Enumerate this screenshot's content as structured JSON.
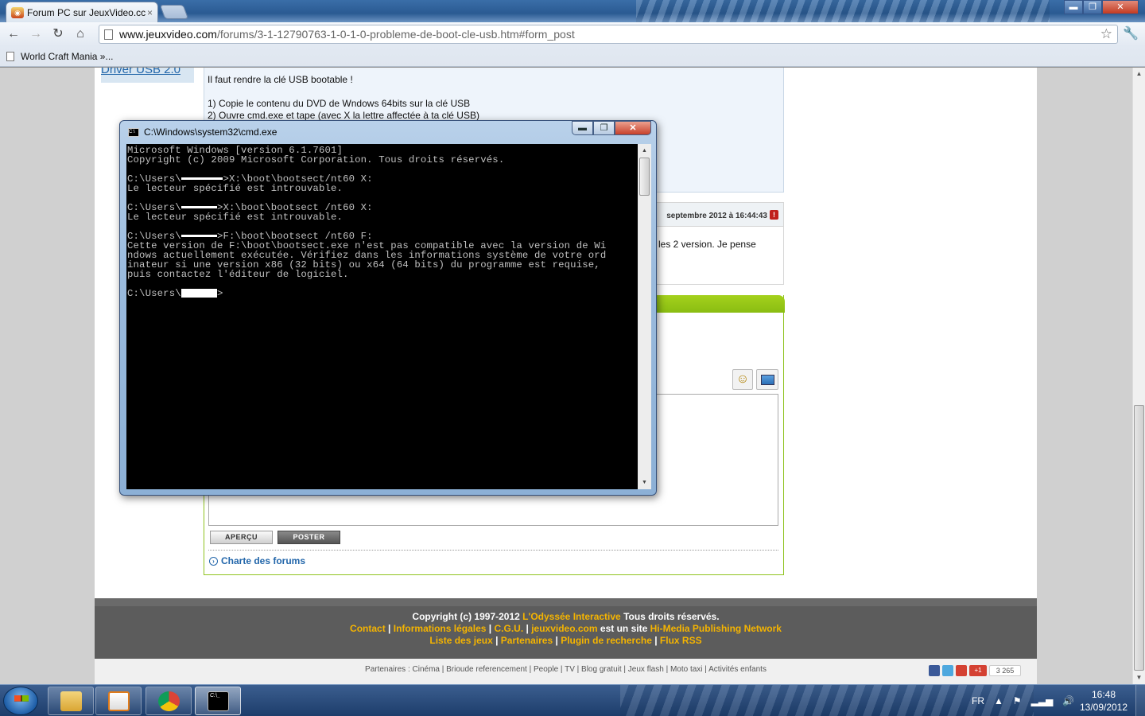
{
  "browser": {
    "tab_title": "Forum PC sur JeuxVideo.cc",
    "tab_close": "×",
    "url_host": "www.jeuxvideo.com",
    "url_path": "/forums/3-1-12790763-1-0-1-0-probleme-de-boot-cle-usb.htm#form_post",
    "bookmark_1": "World Craft Mania »...",
    "window_buttons": {
      "minimize": "▬",
      "maximize": "❐",
      "close": "✕"
    }
  },
  "page": {
    "left_link": "Driver USB 2.0",
    "post1_lines": [
      "Il faut rendre la clé USB bootable !",
      "1) Copie le contenu du DVD de Wndows 64bits sur la clé USB",
      "2) Ouvre cmd.exe et tape (avec X la lettre affectée à ta clé USB)"
    ],
    "post2_date": "septembre 2012 à 16:44:43",
    "post2_alert": "!",
    "post2_text": "les 2 version. Je pense",
    "btn_apercu": "APERÇU",
    "btn_poster": "POSTER",
    "charte_link": "Charte des forums",
    "footer": {
      "line1_a": "Copyright (c) 1997-2012 ",
      "line1_b": "L'Odyssée Interactive",
      "line1_c": " Tous droits réservés.",
      "contact": "Contact",
      "infos": "Informations légales",
      "cgu": "C.G.U.",
      "site": "jeuxvideo.com",
      "est": " est un site ",
      "hmedia": "Hi-Media Publishing Network",
      "liste": "Liste des jeux",
      "partenaires": "Partenaires",
      "plugin": "Plugin de recherche",
      "flux": "Flux RSS"
    },
    "partners_line": "Partenaires : Cinéma | Brioude referencement | People | TV | Blog gratuit | Jeux flash | Moto taxi | Activités enfants",
    "social_count": "3 265",
    "gplus_label": "+1"
  },
  "cmd": {
    "title": "C:\\Windows\\system32\\cmd.exe",
    "lines": [
      "Microsoft Windows [version 6.1.7601]",
      "Copyright (c) 2009 Microsoft Corporation. Tous droits réservés.",
      "",
      "C:\\Users\\       >X:\\boot\\bootsect/nt60 X:",
      "Le lecteur spécifié est introuvable.",
      "",
      "C:\\Users\\      >X:\\boot\\bootsect /nt60 X:",
      "Le lecteur spécifié est introuvable.",
      "",
      "C:\\Users\\      >F:\\boot\\bootsect /nt60 F:",
      "Cette version de F:\\boot\\bootsect.exe n'est pas compatible avec la version de Wi",
      "ndows actuellement exécutée. Vérifiez dans les informations système de votre ord",
      "inateur si une version x86 (32 bits) ou x64 (64 bits) du programme est requise,",
      "puis contactez l'éditeur de logiciel.",
      "",
      "C:\\Users\\      >"
    ]
  },
  "taskbar": {
    "lang": "FR",
    "time": "16:48",
    "date": "13/09/2012",
    "cmd_icon_label": "C:\\_"
  },
  "colors": {
    "accent_green": "#8abd12",
    "link_blue": "#2266aa",
    "footer_yellow": "#f5b400"
  }
}
